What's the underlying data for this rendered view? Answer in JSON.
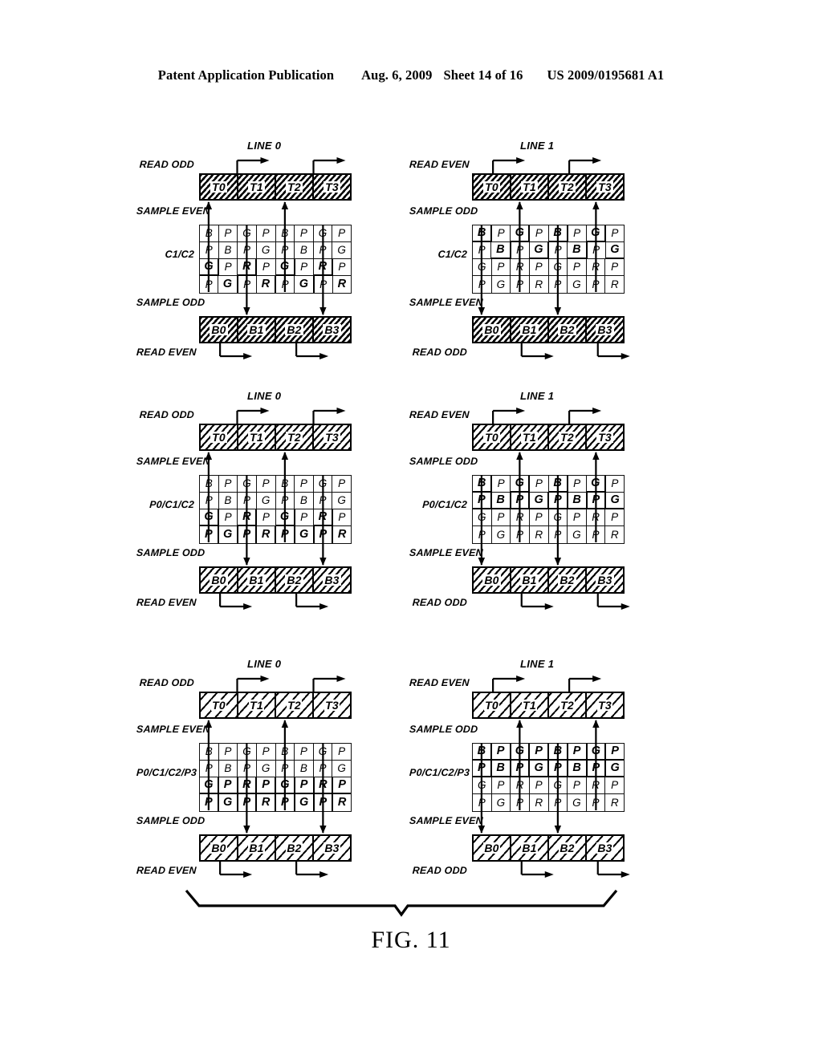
{
  "header": {
    "publication": "Patent Application Publication",
    "date": "Aug. 6, 2009",
    "sheet": "Sheet 14 of 16",
    "number": "US 2009/0195681 A1"
  },
  "figure": {
    "caption": "FIG. 11",
    "top_bar_cells": [
      "T0",
      "T1",
      "T2",
      "T3"
    ],
    "bottom_bar_cells": [
      "B0",
      "B1",
      "B2",
      "B3"
    ],
    "blocks": [
      {
        "id": "block-r1c1",
        "line_title": "LINE 0",
        "label_top_outer": "READ ODD",
        "label_top_inner": "SAMPLE EVEN",
        "label_center": "C1/C2",
        "label_bottom_inner": "SAMPLE ODD",
        "label_bottom_outer": "READ EVEN",
        "hatch": "hatch-dense",
        "parity": "even",
        "grid": [
          [
            "B",
            "P",
            "G",
            "P",
            "B",
            "P",
            "G",
            "P"
          ],
          [
            "P",
            "B",
            "P",
            "G",
            "P",
            "B",
            "P",
            "G"
          ],
          [
            "G",
            "P",
            "R",
            "P",
            "G",
            "P",
            "R",
            "P"
          ],
          [
            "P",
            "G",
            "P",
            "R",
            "P",
            "G",
            "P",
            "R"
          ]
        ],
        "bold": [
          [
            0,
            0,
            0,
            0,
            0,
            0,
            0,
            0
          ],
          [
            0,
            0,
            0,
            0,
            0,
            0,
            0,
            0
          ],
          [
            1,
            0,
            1,
            0,
            1,
            0,
            1,
            0
          ],
          [
            0,
            1,
            0,
            1,
            0,
            1,
            0,
            1
          ]
        ]
      },
      {
        "id": "block-r1c2",
        "line_title": "LINE 1",
        "label_top_outer": "READ EVEN",
        "label_top_inner": "SAMPLE ODD",
        "label_center": "C1/C2",
        "label_bottom_inner": "SAMPLE EVEN",
        "label_bottom_outer": "READ ODD",
        "hatch": "hatch-dense",
        "parity": "odd",
        "grid": [
          [
            "B",
            "P",
            "G",
            "P",
            "B",
            "P",
            "G",
            "P"
          ],
          [
            "P",
            "B",
            "P",
            "G",
            "P",
            "B",
            "P",
            "G"
          ],
          [
            "G",
            "P",
            "R",
            "P",
            "G",
            "P",
            "R",
            "P"
          ],
          [
            "P",
            "G",
            "P",
            "R",
            "P",
            "G",
            "P",
            "R"
          ]
        ],
        "bold": [
          [
            1,
            0,
            1,
            0,
            1,
            0,
            1,
            0
          ],
          [
            0,
            1,
            0,
            1,
            0,
            1,
            0,
            1
          ],
          [
            0,
            0,
            0,
            0,
            0,
            0,
            0,
            0
          ],
          [
            0,
            0,
            0,
            0,
            0,
            0,
            0,
            0
          ]
        ]
      },
      {
        "id": "block-r2c1",
        "line_title": "LINE 0",
        "label_top_outer": "READ ODD",
        "label_top_inner": "SAMPLE EVEN",
        "label_center": "P0/C1/C2",
        "label_bottom_inner": "SAMPLE ODD",
        "label_bottom_outer": "READ EVEN",
        "hatch": "hatch-med",
        "parity": "even",
        "grid": [
          [
            "B",
            "P",
            "G",
            "P",
            "B",
            "P",
            "G",
            "P"
          ],
          [
            "P",
            "B",
            "P",
            "G",
            "P",
            "B",
            "P",
            "G"
          ],
          [
            "G",
            "P",
            "R",
            "P",
            "G",
            "P",
            "R",
            "P"
          ],
          [
            "P",
            "G",
            "P",
            "R",
            "P",
            "G",
            "P",
            "R"
          ]
        ],
        "bold": [
          [
            0,
            0,
            0,
            0,
            0,
            0,
            0,
            0
          ],
          [
            0,
            0,
            0,
            0,
            0,
            0,
            0,
            0
          ],
          [
            1,
            0,
            1,
            0,
            1,
            0,
            1,
            0
          ],
          [
            1,
            1,
            1,
            1,
            1,
            1,
            1,
            1
          ]
        ]
      },
      {
        "id": "block-r2c2",
        "line_title": "LINE 1",
        "label_top_outer": "READ EVEN",
        "label_top_inner": "SAMPLE ODD",
        "label_center": "P0/C1/C2",
        "label_bottom_inner": "SAMPLE EVEN",
        "label_bottom_outer": "READ ODD",
        "hatch": "hatch-med",
        "parity": "odd",
        "grid": [
          [
            "B",
            "P",
            "G",
            "P",
            "B",
            "P",
            "G",
            "P"
          ],
          [
            "P",
            "B",
            "P",
            "G",
            "P",
            "B",
            "P",
            "G"
          ],
          [
            "G",
            "P",
            "R",
            "P",
            "G",
            "P",
            "R",
            "P"
          ],
          [
            "P",
            "G",
            "P",
            "R",
            "P",
            "G",
            "P",
            "R"
          ]
        ],
        "bold": [
          [
            1,
            0,
            1,
            0,
            1,
            0,
            1,
            0
          ],
          [
            1,
            1,
            1,
            1,
            1,
            1,
            1,
            1
          ],
          [
            0,
            0,
            0,
            0,
            0,
            0,
            0,
            0
          ],
          [
            0,
            0,
            0,
            0,
            0,
            0,
            0,
            0
          ]
        ]
      },
      {
        "id": "block-r3c1",
        "line_title": "LINE 0",
        "label_top_outer": "READ ODD",
        "label_top_inner": "SAMPLE EVEN",
        "label_center": "P0/C1/C2/P3",
        "label_bottom_inner": "SAMPLE ODD",
        "label_bottom_outer": "READ EVEN",
        "hatch": "hatch-light",
        "parity": "even",
        "grid": [
          [
            "B",
            "P",
            "G",
            "P",
            "B",
            "P",
            "G",
            "P"
          ],
          [
            "P",
            "B",
            "P",
            "G",
            "P",
            "B",
            "P",
            "G"
          ],
          [
            "G",
            "P",
            "R",
            "P",
            "G",
            "P",
            "R",
            "P"
          ],
          [
            "P",
            "G",
            "P",
            "R",
            "P",
            "G",
            "P",
            "R"
          ]
        ],
        "bold": [
          [
            0,
            0,
            0,
            0,
            0,
            0,
            0,
            0
          ],
          [
            0,
            0,
            0,
            0,
            0,
            0,
            0,
            0
          ],
          [
            1,
            1,
            1,
            1,
            1,
            1,
            1,
            1
          ],
          [
            1,
            1,
            1,
            1,
            1,
            1,
            1,
            1
          ]
        ]
      },
      {
        "id": "block-r3c2",
        "line_title": "LINE 1",
        "label_top_outer": "READ EVEN",
        "label_top_inner": "SAMPLE ODD",
        "label_center": "P0/C1/C2/P3",
        "label_bottom_inner": "SAMPLE EVEN",
        "label_bottom_outer": "READ ODD",
        "hatch": "hatch-light",
        "parity": "odd",
        "grid": [
          [
            "B",
            "P",
            "G",
            "P",
            "B",
            "P",
            "G",
            "P"
          ],
          [
            "P",
            "B",
            "P",
            "G",
            "P",
            "B",
            "P",
            "G"
          ],
          [
            "G",
            "P",
            "R",
            "P",
            "G",
            "P",
            "R",
            "P"
          ],
          [
            "P",
            "G",
            "P",
            "R",
            "P",
            "G",
            "P",
            "R"
          ]
        ],
        "bold": [
          [
            1,
            1,
            1,
            1,
            1,
            1,
            1,
            1
          ],
          [
            1,
            1,
            1,
            1,
            1,
            1,
            1,
            1
          ],
          [
            0,
            0,
            0,
            0,
            0,
            0,
            0,
            0
          ],
          [
            0,
            0,
            0,
            0,
            0,
            0,
            0,
            0
          ]
        ]
      }
    ]
  }
}
